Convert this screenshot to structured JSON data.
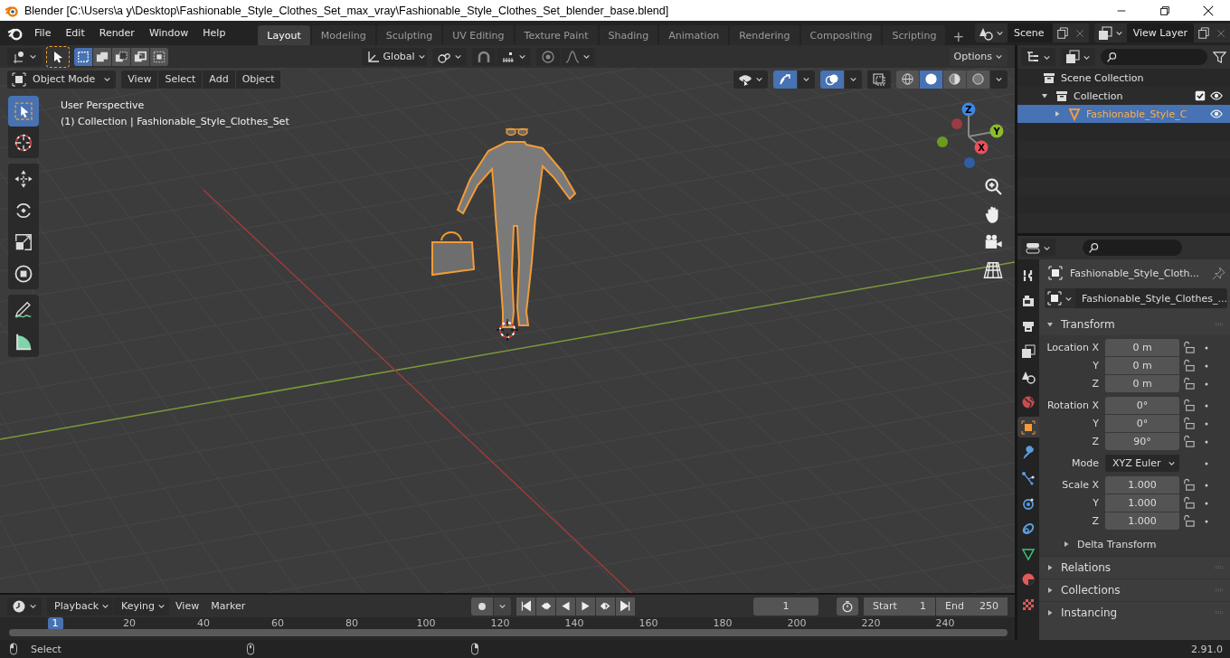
{
  "window": {
    "title": "Blender [C:\\Users\\a y\\Desktop\\Fashionable_Style_Clothes_Set_max_vray\\Fashionable_Style_Clothes_Set_blender_base.blend]"
  },
  "menu": [
    "File",
    "Edit",
    "Render",
    "Window",
    "Help"
  ],
  "workspace_tabs": [
    {
      "label": "Layout",
      "selected": true
    },
    {
      "label": "Modeling",
      "selected": false
    },
    {
      "label": "Sculpting",
      "selected": false
    },
    {
      "label": "UV Editing",
      "selected": false
    },
    {
      "label": "Texture Paint",
      "selected": false
    },
    {
      "label": "Shading",
      "selected": false
    },
    {
      "label": "Animation",
      "selected": false
    },
    {
      "label": "Rendering",
      "selected": false
    },
    {
      "label": "Compositing",
      "selected": false
    },
    {
      "label": "Scripting",
      "selected": false
    }
  ],
  "add_workspace": "+",
  "scene": "Scene",
  "view_layer": "View Layer",
  "tool_settings": {
    "select_modes": [
      {
        "kind": "set",
        "selected": true
      },
      {
        "kind": "extend",
        "selected": false
      },
      {
        "kind": "subtract",
        "selected": false
      },
      {
        "kind": "invert",
        "selected": false
      },
      {
        "kind": "intersect",
        "selected": false
      }
    ],
    "orientation": "Global",
    "options": "Options"
  },
  "viewport": {
    "mode": "Object Mode",
    "menus": [
      "View",
      "Select",
      "Add",
      "Object"
    ],
    "toggles": [
      {
        "kind": "gizmos",
        "on": true
      },
      {
        "kind": "overlays",
        "on": true
      },
      {
        "kind": "xray",
        "on": false
      }
    ],
    "shading": [
      {
        "kind": "wireframe",
        "selected": false
      },
      {
        "kind": "solid",
        "selected": true
      },
      {
        "kind": "material",
        "selected": false
      },
      {
        "kind": "rendered",
        "selected": false
      }
    ],
    "view_name": "User Perspective",
    "context": "(1) Collection | Fashionable_Style_Clothes_Set",
    "tool_groups": [
      [
        {
          "kind": "select",
          "selected": true
        },
        {
          "kind": "cursor",
          "selected": false
        }
      ],
      [
        {
          "kind": "move",
          "selected": false
        },
        {
          "kind": "rotate",
          "selected": false
        },
        {
          "kind": "scale",
          "selected": false
        },
        {
          "kind": "transform",
          "selected": false
        }
      ],
      [
        {
          "kind": "annotate",
          "selected": false
        },
        {
          "kind": "measure",
          "selected": false
        }
      ]
    ],
    "gizmo": [
      "X",
      "Y",
      "Z"
    ]
  },
  "outliner": {
    "tree": [
      {
        "label": "Scene Collection",
        "kind": "scene_collection",
        "selected": false,
        "children": [
          {
            "label": "Collection",
            "kind": "collection",
            "expanded": true,
            "checked": true,
            "visible": true,
            "selected": false,
            "children": [
              {
                "label": "Fashionable_Style_C",
                "kind": "mesh",
                "expanded": false,
                "visible": true,
                "selected": true
              }
            ]
          }
        ]
      }
    ]
  },
  "properties": {
    "tabs": [
      {
        "kind": "tool",
        "selected": false
      },
      {
        "kind": "render",
        "selected": false
      },
      {
        "kind": "output",
        "selected": false
      },
      {
        "kind": "view_layer",
        "selected": false
      },
      {
        "kind": "scene",
        "selected": false
      },
      {
        "kind": "world",
        "selected": false
      },
      {
        "kind": "object",
        "selected": true
      },
      {
        "kind": "modifiers",
        "selected": false
      },
      {
        "kind": "particles",
        "selected": false
      },
      {
        "kind": "physics",
        "selected": false
      },
      {
        "kind": "constraints",
        "selected": false
      },
      {
        "kind": "data",
        "selected": false
      },
      {
        "kind": "material",
        "selected": false
      },
      {
        "kind": "texture",
        "selected": false
      }
    ],
    "object_name": "Fashionable_Style_Cloth...",
    "data_name": "Fashionable_Style_Clothes_...",
    "transform": {
      "label": "Transform",
      "expanded": true,
      "groups": [
        {
          "kind": "vector",
          "rows": [
            {
              "label": "Location X",
              "value": "0 m"
            },
            {
              "label": "Y",
              "value": "0 m"
            },
            {
              "label": "Z",
              "value": "0 m"
            }
          ]
        },
        {
          "kind": "vector",
          "rows": [
            {
              "label": "Rotation X",
              "value": "0°"
            },
            {
              "label": "Y",
              "value": "0°"
            },
            {
              "label": "Z",
              "value": "90°"
            }
          ]
        },
        {
          "kind": "enum",
          "rows": [
            {
              "label": "Mode",
              "value": "XYZ Euler"
            }
          ]
        },
        {
          "kind": "vector",
          "rows": [
            {
              "label": "Scale X",
              "value": "1.000"
            },
            {
              "label": "Y",
              "value": "1.000"
            },
            {
              "label": "Z",
              "value": "1.000"
            }
          ]
        }
      ],
      "subpanels": [
        {
          "label": "Delta Transform",
          "expanded": false
        }
      ]
    },
    "panels": [
      {
        "label": "Relations",
        "expanded": false
      },
      {
        "label": "Collections",
        "expanded": false
      },
      {
        "label": "Instancing",
        "expanded": false
      }
    ]
  },
  "timeline": {
    "menus": [
      {
        "label": "Playback",
        "dropdown": true
      },
      {
        "label": "Keying",
        "dropdown": true
      },
      {
        "label": "View",
        "dropdown": false
      },
      {
        "label": "Marker",
        "dropdown": false
      }
    ],
    "current_frame": "1",
    "start_label": "Start",
    "start": "1",
    "end_label": "End",
    "end": "250",
    "ruler": [
      {
        "label": "1",
        "selected": true
      },
      {
        "label": "20",
        "selected": false
      },
      {
        "label": "40",
        "selected": false
      },
      {
        "label": "60",
        "selected": false
      },
      {
        "label": "80",
        "selected": false
      },
      {
        "label": "100",
        "selected": false
      },
      {
        "label": "120",
        "selected": false
      },
      {
        "label": "140",
        "selected": false
      },
      {
        "label": "160",
        "selected": false
      },
      {
        "label": "180",
        "selected": false
      },
      {
        "label": "200",
        "selected": false
      },
      {
        "label": "220",
        "selected": false
      },
      {
        "label": "240",
        "selected": false
      }
    ]
  },
  "status_bar": {
    "action": "Select",
    "version": "2.91.0"
  }
}
